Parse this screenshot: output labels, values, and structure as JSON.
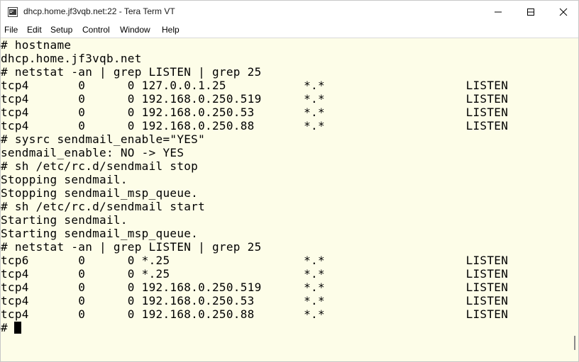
{
  "window": {
    "title": "dhcp.home.jf3vqb.net:22 - Tera Term VT"
  },
  "menu": {
    "items": [
      "File",
      "Edit",
      "Setup",
      "Control",
      "Window",
      "Help"
    ]
  },
  "terminal": {
    "lines": [
      "# hostname",
      "dhcp.home.jf3vqb.net",
      "# netstat -an | grep LISTEN | grep 25",
      "tcp4       0      0 127.0.0.1.25           *.*                    LISTEN",
      "tcp4       0      0 192.168.0.250.519      *.*                    LISTEN",
      "tcp4       0      0 192.168.0.250.53       *.*                    LISTEN",
      "tcp4       0      0 192.168.0.250.88       *.*                    LISTEN",
      "# sysrc sendmail_enable=\"YES\"",
      "sendmail_enable: NO -> YES",
      "# sh /etc/rc.d/sendmail stop",
      "Stopping sendmail.",
      "Stopping sendmail_msp_queue.",
      "# sh /etc/rc.d/sendmail start",
      "Starting sendmail.",
      "Starting sendmail_msp_queue.",
      "# netstat -an | grep LISTEN | grep 25",
      "tcp6       0      0 *.25                   *.*                    LISTEN",
      "tcp4       0      0 *.25                   *.*                    LISTEN",
      "tcp4       0      0 192.168.0.250.519      *.*                    LISTEN",
      "tcp4       0      0 192.168.0.250.53       *.*                    LISTEN",
      "tcp4       0      0 192.168.0.250.88       *.*                    LISTEN",
      "# "
    ]
  },
  "colors": {
    "terminal_bg": "#fdfde8",
    "terminal_fg": "#000000"
  }
}
